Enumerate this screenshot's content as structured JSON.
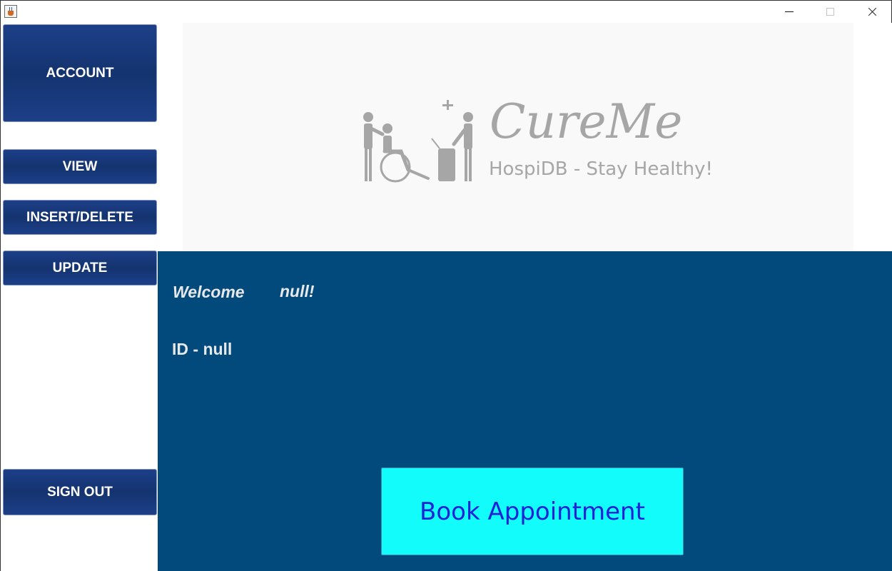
{
  "window": {
    "icon": "java-cup-icon",
    "controls": [
      "minimize",
      "maximize",
      "close"
    ]
  },
  "sidebar": {
    "account": "ACCOUNT",
    "view": "VIEW",
    "insert_delete": "INSERT/DELETE",
    "update": "UPDATE",
    "sign_out": "SIGN OUT"
  },
  "logo": {
    "title": "CureMe",
    "tagline": "HospiDB - Stay Healthy!",
    "icon": "hospital-care-logo-icon"
  },
  "main": {
    "welcome_label": "Welcome",
    "user_name": "null!",
    "user_id": "ID - null",
    "book_button": "Book Appointment"
  },
  "colors": {
    "nav_button": "#16377a",
    "main_background": "#024a7b",
    "book_button_bg": "#12fcfc",
    "book_button_text": "#2121d6",
    "logo_gray": "#a6a6a6"
  }
}
